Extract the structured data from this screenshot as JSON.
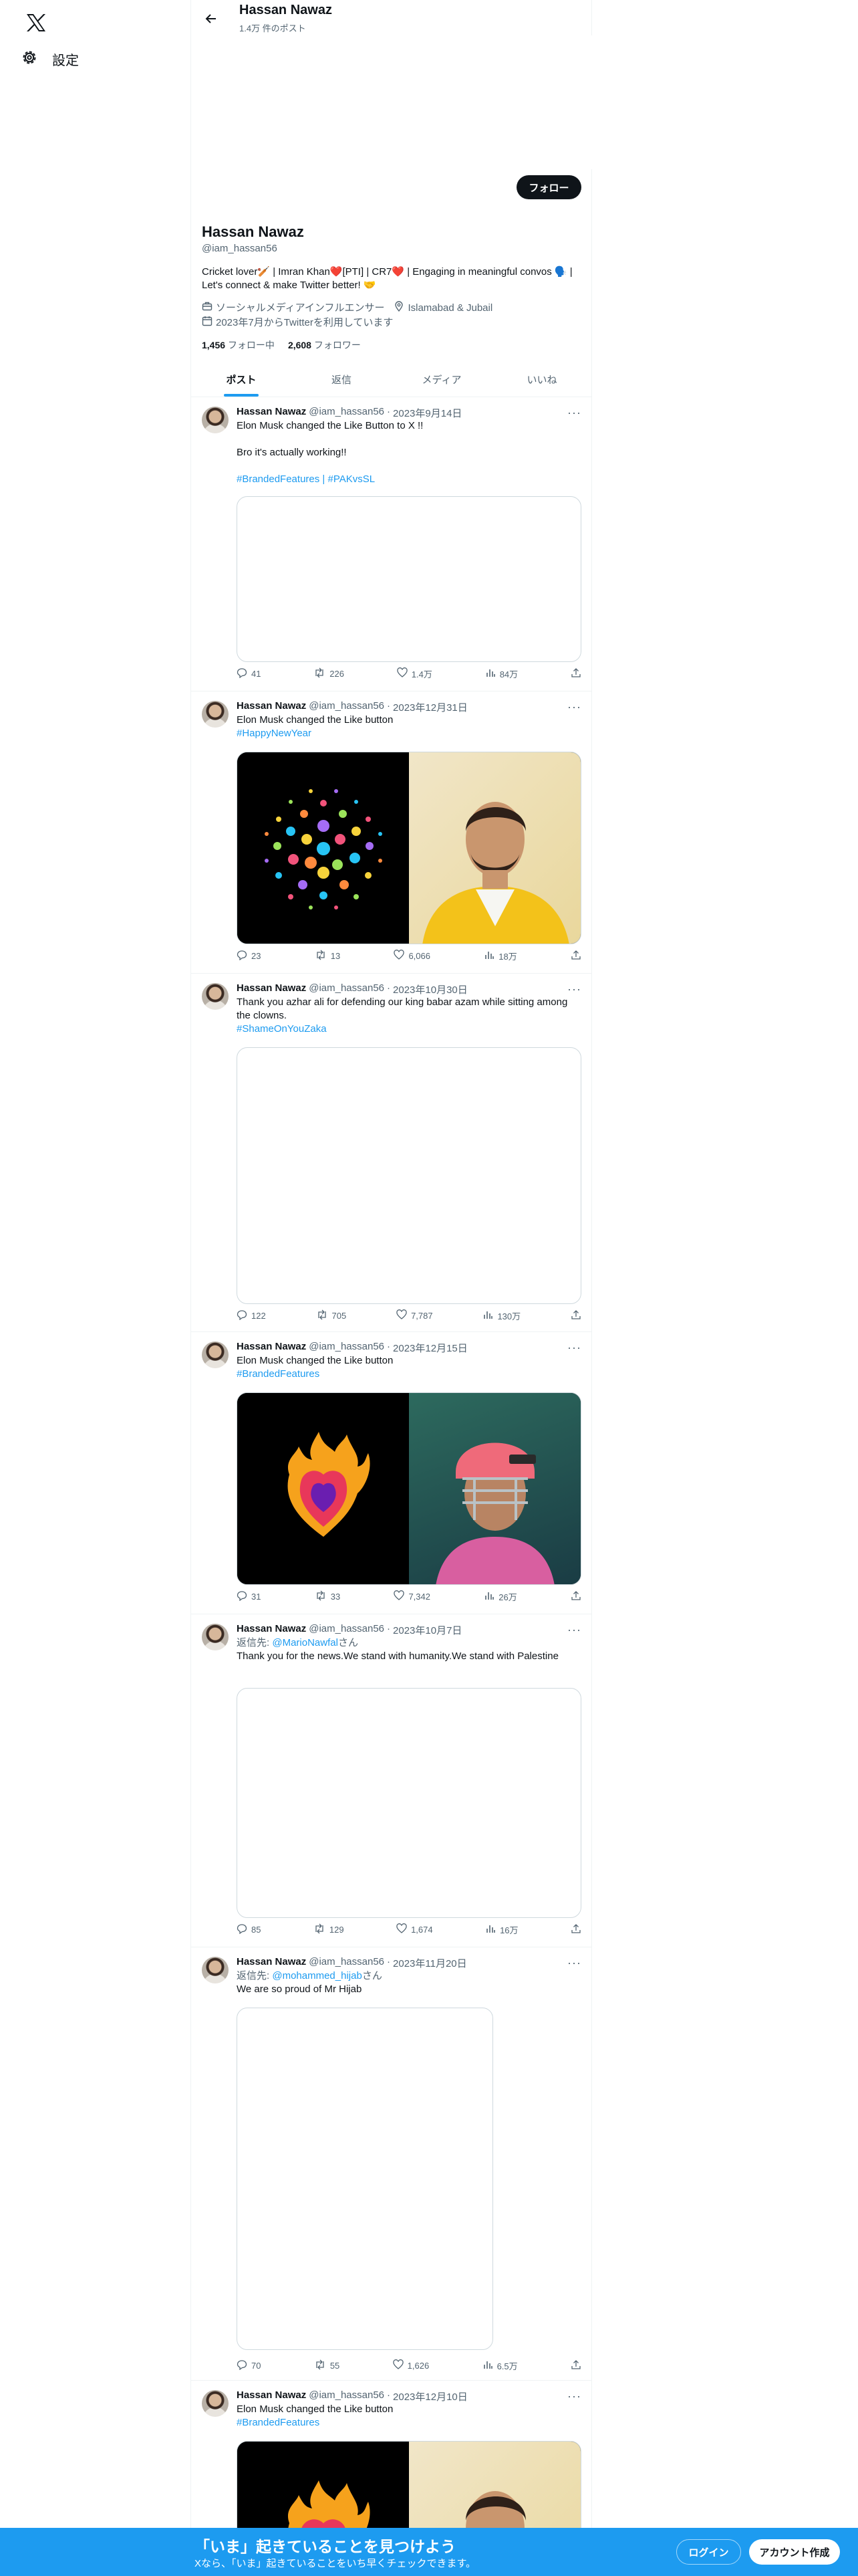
{
  "nav": {
    "settings_label": "設定"
  },
  "header": {
    "name": "Hassan Nawaz",
    "post_count": "1.4万 件のポスト"
  },
  "profile": {
    "follow_label": "フォロー",
    "name": "Hassan Nawaz",
    "handle": "@iam_hassan56",
    "bio": "Cricket lover🏏 | Imran Khan❤️[PTI] | CR7❤️ | Engaging in meaningful convos 🗣️ | Let's connect & make Twitter better! 🤝",
    "category": "ソーシャルメディアインフルエンサー",
    "location": "Islamabad & Jubail",
    "joined": "2023年7月からTwitterを利用しています",
    "following_count": "1,456",
    "following_label": "フォロー中",
    "followers_count": "2,608",
    "followers_label": "フォロワー"
  },
  "tabs": [
    "ポスト",
    "返信",
    "メディア",
    "いいね"
  ],
  "tweets": [
    {
      "name": "Hassan Nawaz",
      "handle": "@iam_hassan56",
      "sep": "·",
      "date": "2023年9月14日",
      "text": "Elon Musk changed the Like Button to X !!\n\nBro it's actually working!!",
      "tags": "#BrandedFeatures | #PAKvsSL",
      "replies": "41",
      "reposts": "226",
      "likes": "1.4万",
      "views": "84万"
    },
    {
      "name": "Hassan Nawaz",
      "handle": "@iam_hassan56",
      "sep": "·",
      "date": "2023年12月31日",
      "text": "Elon Musk changed the Like button",
      "tags": "#HappyNewYear",
      "replies": "23",
      "reposts": "13",
      "likes": "6,066",
      "views": "18万"
    },
    {
      "name": "Hassan Nawaz",
      "handle": "@iam_hassan56",
      "sep": "·",
      "date": "2023年10月30日",
      "text": "Thank you azhar ali for defending our king babar azam while sitting among the clowns.",
      "tags": "#ShameOnYouZaka",
      "replies": "122",
      "reposts": "705",
      "likes": "7,787",
      "views": "130万"
    },
    {
      "name": "Hassan Nawaz",
      "handle": "@iam_hassan56",
      "sep": "·",
      "date": "2023年12月15日",
      "text": "Elon Musk changed the Like button",
      "tags": "#BrandedFeatures",
      "replies": "31",
      "reposts": "33",
      "likes": "7,342",
      "views": "26万"
    },
    {
      "name": "Hassan Nawaz",
      "handle": "@iam_hassan56",
      "sep": "·",
      "date": "2023年10月7日",
      "reply_prefix": "返信先:",
      "reply_to": "@MarioNawfal",
      "reply_suffix": "さん",
      "text": "Thank you for the news.We stand with humanity.We stand with Palestine",
      "replies": "85",
      "reposts": "129",
      "likes": "1,674",
      "views": "16万"
    },
    {
      "name": "Hassan Nawaz",
      "handle": "@iam_hassan56",
      "sep": "·",
      "date": "2023年11月20日",
      "reply_prefix": "返信先:",
      "reply_to": "@mohammed_hijab",
      "reply_suffix": "さん",
      "text": "We are so proud of Mr Hijab",
      "replies": "70",
      "reposts": "55",
      "likes": "1,626",
      "views": "6.5万"
    },
    {
      "name": "Hassan Nawaz",
      "handle": "@iam_hassan56",
      "sep": "·",
      "date": "2023年12月10日",
      "text": "Elon Musk changed the Like button",
      "tags": "#BrandedFeatures"
    }
  ],
  "bottom": {
    "title": "「いま」起きていることを見つけよう",
    "subtitle": "Xなら、「いま」起きていることをいち早くチェックできます。",
    "login": "ログイン",
    "signup": "アカウント作成"
  },
  "colors": {
    "accent": "#1d9bf0",
    "text": "#0f1419",
    "muted": "#536471"
  }
}
